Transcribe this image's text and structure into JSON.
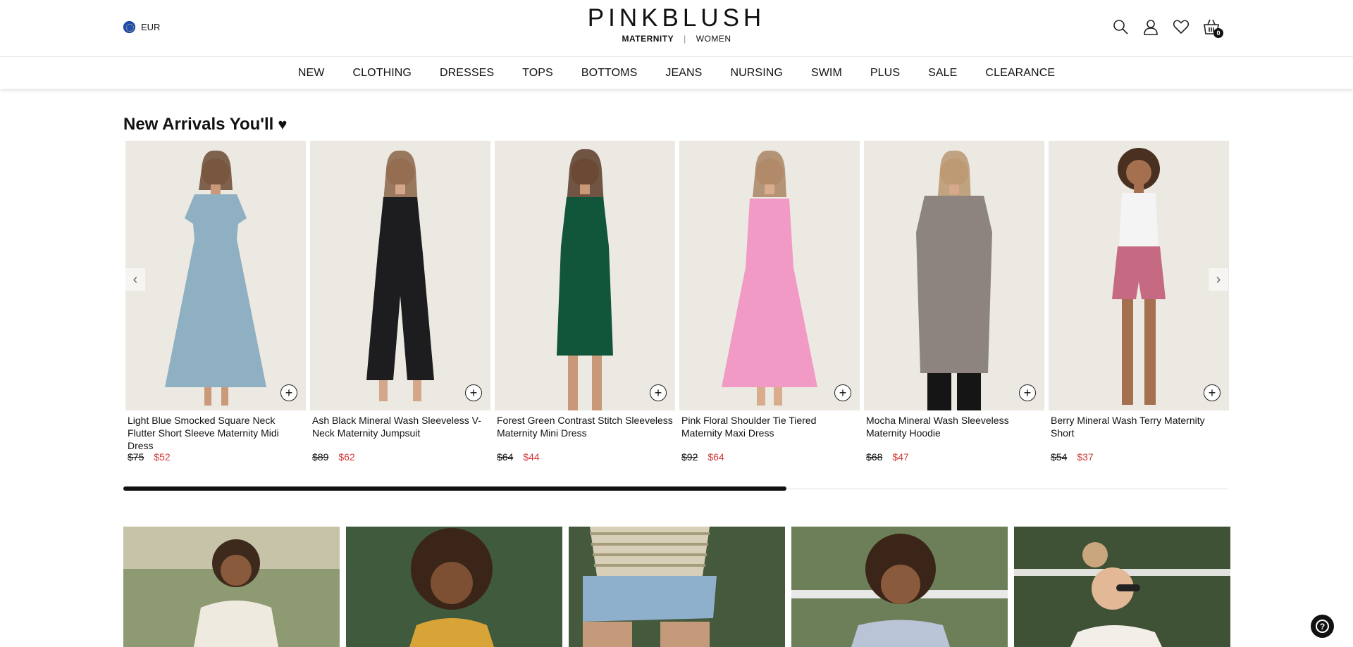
{
  "header": {
    "currency": "EUR",
    "logo": "PINKBLUSH",
    "logo_maternity": "MATERNITY",
    "logo_sep": "|",
    "logo_women": "WOMEN",
    "cart_count": "0"
  },
  "nav": [
    "NEW",
    "CLOTHING",
    "DRESSES",
    "TOPS",
    "BOTTOMS",
    "JEANS",
    "NURSING",
    "SWIM",
    "PLUS",
    "SALE",
    "CLEARANCE"
  ],
  "section": {
    "title": "New Arrivals You'll",
    "title_icon": "♥"
  },
  "products": [
    {
      "name": "Light Blue Smocked Square Neck Flutter Short Sleeve Maternity Midi Dress",
      "orig_price": "$75",
      "sale_price": "$52",
      "color": "#8fb0c2"
    },
    {
      "name": "Ash Black Mineral Wash Sleeveless V-Neck Maternity Jumpsuit",
      "orig_price": "$89",
      "sale_price": "$62",
      "color": "#1d1d1f"
    },
    {
      "name": "Forest Green Contrast Stitch Sleeveless Maternity Mini Dress",
      "orig_price": "$64",
      "sale_price": "$44",
      "color": "#11553a"
    },
    {
      "name": "Pink Floral Shoulder Tie Tiered Maternity Maxi Dress",
      "orig_price": "$92",
      "sale_price": "$64",
      "color": "#f29ac6"
    },
    {
      "name": "Mocha Mineral Wash Sleeveless Maternity Hoodie",
      "orig_price": "$68",
      "sale_price": "$47",
      "color": "#8d8480"
    },
    {
      "name": "Berry Mineral Wash Terry Maternity Short",
      "orig_price": "$54",
      "sale_price": "$37",
      "color": "#c56a82"
    }
  ],
  "add_label": "+",
  "arrows": {
    "prev": "‹",
    "next": "›"
  },
  "carousel_progress": 0.6,
  "help": "?",
  "colors": {
    "sale": "#d0383a",
    "text": "#111111"
  }
}
